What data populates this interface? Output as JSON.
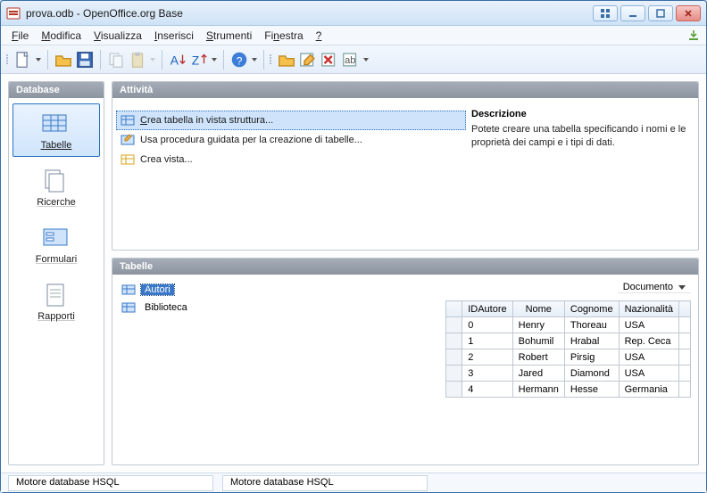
{
  "title": "prova.odb - OpenOffice.org Base",
  "menus": {
    "items": [
      "File",
      "Modifica",
      "Visualizza",
      "Inserisci",
      "Strumenti",
      "Finestra",
      "?"
    ]
  },
  "sidebar": {
    "header": "Database",
    "items": [
      {
        "label": "Tabelle"
      },
      {
        "label": "Ricerche"
      },
      {
        "label": "Formulari"
      },
      {
        "label": "Rapporti"
      }
    ]
  },
  "tasks": {
    "header": "Attività",
    "items": [
      {
        "label": "Crea tabella in vista struttura..."
      },
      {
        "label": "Usa procedura guidata per la creazione di tabelle..."
      },
      {
        "label": "Crea vista..."
      }
    ],
    "desc_header": "Descrizione",
    "desc_text": "Potete creare una tabella specificando i nomi e le proprietà dei campi e i tipi di dati."
  },
  "tables": {
    "header": "Tabelle",
    "tree": [
      "Autori",
      "Biblioteca"
    ],
    "doc_label": "Documento",
    "columns": [
      "IDAutore",
      "Nome",
      "Cognome",
      "Nazionalità"
    ],
    "rows": [
      [
        "0",
        "Henry",
        "Thoreau",
        "USA"
      ],
      [
        "1",
        "Bohumil",
        "Hrabal",
        "Rep. Ceca"
      ],
      [
        "2",
        "Robert",
        "Pirsig",
        "USA"
      ],
      [
        "3",
        "Jared",
        "Diamond",
        "USA"
      ],
      [
        "4",
        "Hermann",
        "Hesse",
        "Germania"
      ]
    ]
  },
  "status": {
    "left": "Motore database HSQL",
    "right": "Motore database HSQL"
  }
}
